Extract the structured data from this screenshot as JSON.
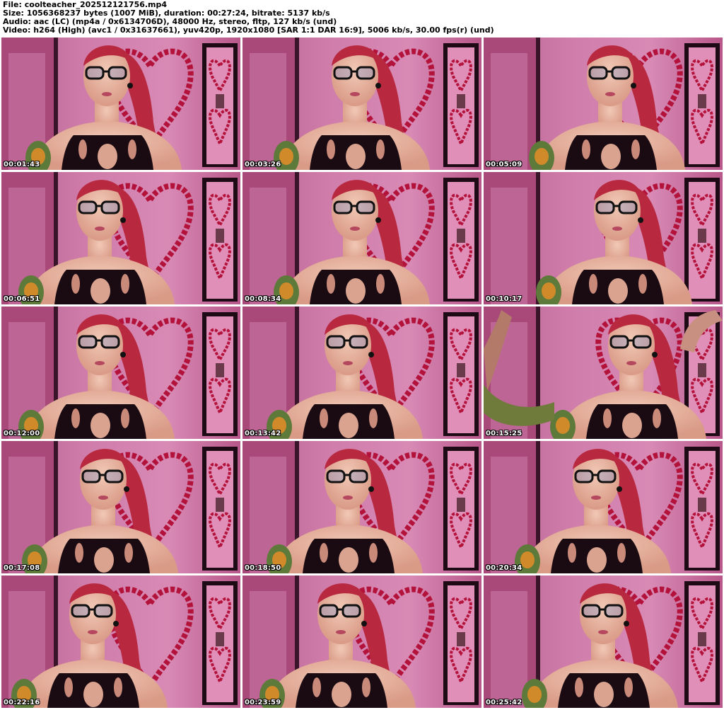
{
  "header": {
    "line1": "File: coolteacher_202512121756.mp4",
    "line2": "Size: 1056368237 bytes (1007 MiB), duration: 00:27:24, bitrate: 5137 kb/s",
    "line3": "Audio: aac (LC) (mp4a / 0x6134706D), 48000 Hz, stereo, fltp, 127 kb/s (und)",
    "line4": "Video: h264 (High) (avc1 / 0x31637661), yuv420p, 1920x1080 [SAR 1:1 DAR 16:9], 5006 kb/s, 30.00 fps(r) (und)"
  },
  "thumbnails": [
    {
      "timestamp": "00:01:43"
    },
    {
      "timestamp": "00:03:26"
    },
    {
      "timestamp": "00:05:09"
    },
    {
      "timestamp": "00:06:51"
    },
    {
      "timestamp": "00:08:34"
    },
    {
      "timestamp": "00:10:17"
    },
    {
      "timestamp": "00:12:00"
    },
    {
      "timestamp": "00:13:42"
    },
    {
      "timestamp": "00:15:25"
    },
    {
      "timestamp": "00:17:08"
    },
    {
      "timestamp": "00:18:50"
    },
    {
      "timestamp": "00:20:34"
    },
    {
      "timestamp": "00:22:16"
    },
    {
      "timestamp": "00:23:59"
    },
    {
      "timestamp": "00:25:42"
    }
  ],
  "colors": {
    "wall": "#cf7aa9",
    "frame": "#1d0a14",
    "heart": "#b3123a",
    "skin": "#e9b8a4",
    "hair": "#b8283f",
    "top": "#1a0a12",
    "timestamp_text": "#ffffff"
  }
}
